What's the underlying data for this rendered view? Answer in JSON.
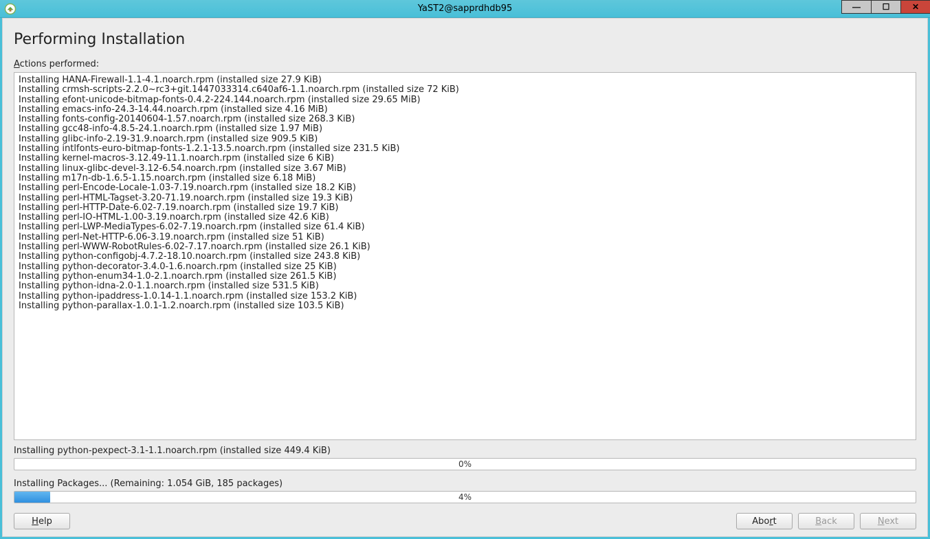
{
  "window": {
    "title": "YaST2@sapprdhdb95"
  },
  "page": {
    "heading": "Performing Installation",
    "actions_label_prefix": "A",
    "actions_label_rest": "ctions performed:"
  },
  "log_lines": [
    "Installing HANA-Firewall-1.1-4.1.noarch.rpm (installed size 27.9 KiB)",
    "Installing crmsh-scripts-2.2.0~rc3+git.1447033314.c640af6-1.1.noarch.rpm (installed size 72 KiB)",
    "Installing efont-unicode-bitmap-fonts-0.4.2-224.144.noarch.rpm (installed size 29.65 MiB)",
    "Installing emacs-info-24.3-14.44.noarch.rpm (installed size 4.16 MiB)",
    "Installing fonts-config-20140604-1.57.noarch.rpm (installed size 268.3 KiB)",
    "Installing gcc48-info-4.8.5-24.1.noarch.rpm (installed size 1.97 MiB)",
    "Installing glibc-info-2.19-31.9.noarch.rpm (installed size 909.5 KiB)",
    "Installing intlfonts-euro-bitmap-fonts-1.2.1-13.5.noarch.rpm (installed size 231.5 KiB)",
    "Installing kernel-macros-3.12.49-11.1.noarch.rpm (installed size 6 KiB)",
    "Installing linux-glibc-devel-3.12-6.54.noarch.rpm (installed size 3.67 MiB)",
    "Installing m17n-db-1.6.5-1.15.noarch.rpm (installed size 6.18 MiB)",
    "Installing perl-Encode-Locale-1.03-7.19.noarch.rpm (installed size 18.2 KiB)",
    "Installing perl-HTML-Tagset-3.20-71.19.noarch.rpm (installed size 19.3 KiB)",
    "Installing perl-HTTP-Date-6.02-7.19.noarch.rpm (installed size 19.7 KiB)",
    "Installing perl-IO-HTML-1.00-3.19.noarch.rpm (installed size 42.6 KiB)",
    "Installing perl-LWP-MediaTypes-6.02-7.19.noarch.rpm (installed size 61.4 KiB)",
    "Installing perl-Net-HTTP-6.06-3.19.noarch.rpm (installed size 51 KiB)",
    "Installing perl-WWW-RobotRules-6.02-7.17.noarch.rpm (installed size 26.1 KiB)",
    "Installing python-configobj-4.7.2-18.10.noarch.rpm (installed size 243.8 KiB)",
    "Installing python-decorator-3.4.0-1.6.noarch.rpm (installed size 25 KiB)",
    "Installing python-enum34-1.0-2.1.noarch.rpm (installed size 261.5 KiB)",
    "Installing python-idna-2.0-1.1.noarch.rpm (installed size 531.5 KiB)",
    "Installing python-ipaddress-1.0.14-1.1.noarch.rpm (installed size 153.2 KiB)",
    "Installing python-parallax-1.0.1-1.2.noarch.rpm (installed size 103.5 KiB)"
  ],
  "current_package": {
    "status": "Installing python-pexpect-3.1-1.1.noarch.rpm (installed size 449.4 KiB)",
    "percent_label": "0%",
    "percent_value": 0
  },
  "overall": {
    "status": "Installing Packages... (Remaining: 1.054 GiB, 185 packages)",
    "percent_label": "4%",
    "percent_value": 4
  },
  "buttons": {
    "help_prefix": "H",
    "help_rest": "elp",
    "abort_prefix": "Abo",
    "abort_underline": "r",
    "abort_rest": "t",
    "back_prefix": "",
    "back_underline": "B",
    "back_rest": "ack",
    "next_prefix": "",
    "next_underline": "N",
    "next_rest": "ext"
  }
}
